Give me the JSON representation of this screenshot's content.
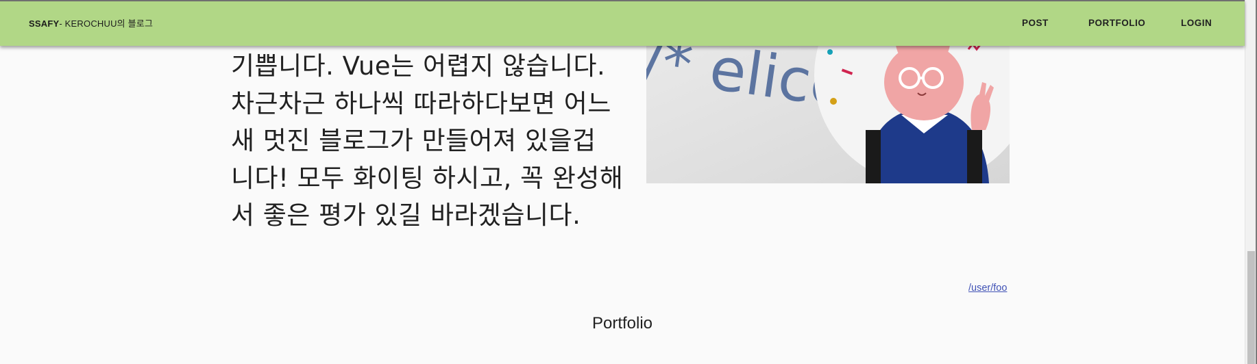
{
  "header": {
    "brand_strong": "SSAFY",
    "brand_rest": "- KEROCHUU의 블로그",
    "nav": [
      "POST",
      "PORTFOLIO",
      "LOGIN"
    ]
  },
  "intro": {
    "lines": [
      "기쁩니다. Vue는 어렵지 않습니다.",
      "차근차근 하나씩 따라하다보면 어느",
      "새 멋진 블로그가 만들어져 있을겁",
      "니다! 모두 화이팅 하시고, 꼭 완성해",
      "서 좋은 평가 있길 바라겠습니다."
    ]
  },
  "photo": {
    "wall_text": "/* elice",
    "mascot": "rabbit-mascot-illustration"
  },
  "link": {
    "text": "/user/foo"
  },
  "section": {
    "title": "Portfolio"
  },
  "colors": {
    "header_bg": "#b1d786",
    "link": "#3f51b5",
    "mascot_body": "#1e3a8a",
    "mascot_face": "#f0a5a5"
  }
}
